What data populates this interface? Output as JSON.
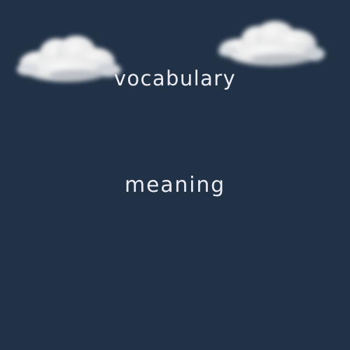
{
  "background_color": "#213247",
  "text_color": "#ececf4",
  "text_items": {
    "top_word": "vocabulary",
    "middle_word": "meaning"
  },
  "decorations": {
    "left_cloud": "cloud-icon",
    "right_cloud": "cloud-icon"
  }
}
